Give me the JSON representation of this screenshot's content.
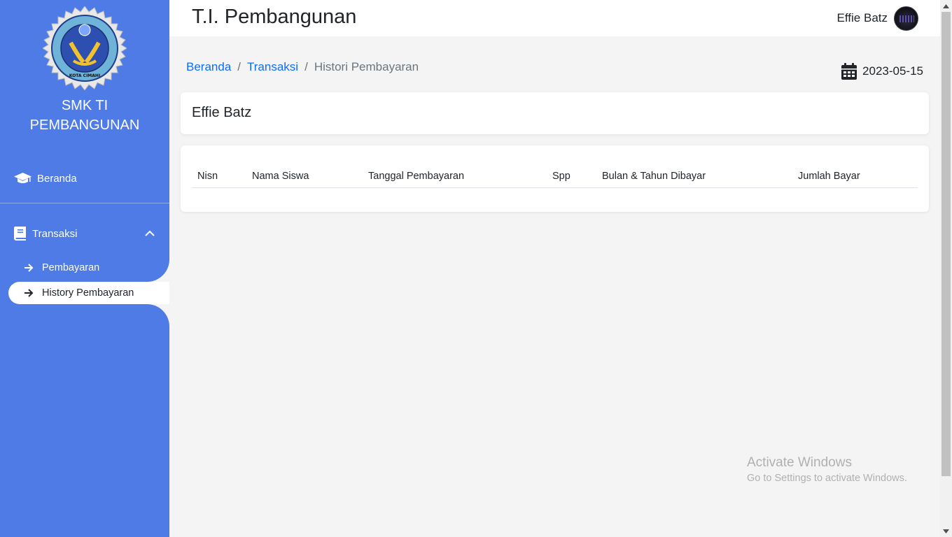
{
  "sidebar": {
    "school_line1": "SMK TI",
    "school_line2": "PEMBANGUNAN",
    "logo_icon": "school-seal-logo",
    "items": [
      {
        "label": "Beranda",
        "icon": "graduation-cap-icon"
      },
      {
        "label": "Transaksi",
        "icon": "book-icon",
        "expanded": true
      }
    ],
    "subitems": [
      {
        "label": "Pembayaran",
        "icon": "arrow-right-icon",
        "active": false
      },
      {
        "label": "History Pembayaran",
        "icon": "arrow-right-icon",
        "active": true
      }
    ]
  },
  "topbar": {
    "title": "T.I. Pembangunan",
    "user_name": "Effie Batz"
  },
  "breadcrumb": {
    "items": [
      "Beranda",
      "Transaksi",
      "Histori Pembayaran"
    ]
  },
  "date": "2023-05-15",
  "student_card": {
    "name": "Effie Batz"
  },
  "table": {
    "columns": [
      "Nisn",
      "Nama Siswa",
      "Tanggal Pembayaran",
      "Spp",
      "Bulan & Tahun Dibayar",
      "Jumlah Bayar"
    ],
    "rows": []
  },
  "watermark": {
    "line1": "Activate Windows",
    "line2": "Go to Settings to activate Windows."
  },
  "colors": {
    "sidebar": "#4e7be5",
    "link": "#0d6efd",
    "background": "#f4f4f4"
  }
}
